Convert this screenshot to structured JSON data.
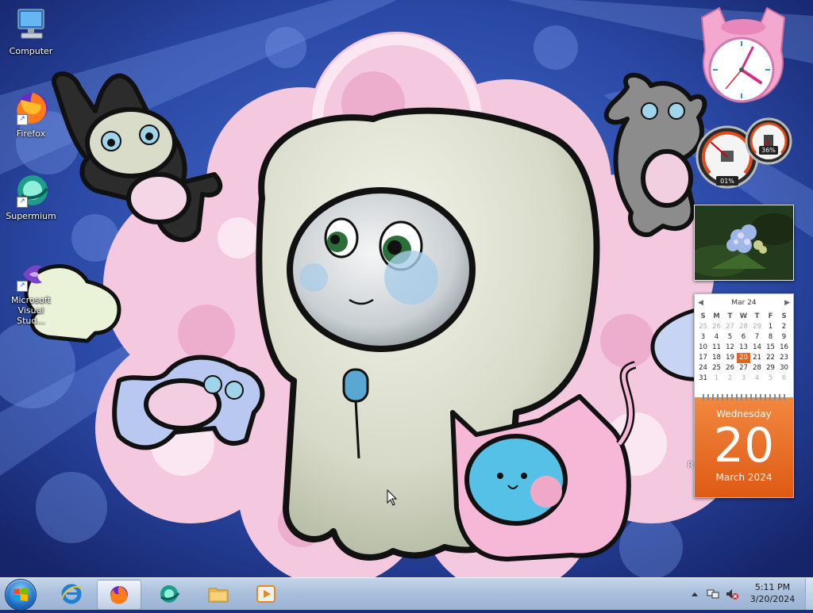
{
  "desktop": {
    "icons": [
      {
        "label": "Computer",
        "icon": "computer-icon"
      },
      {
        "label": "Firefox",
        "icon": "firefox-icon"
      },
      {
        "label": "Supermium",
        "icon": "supermium-icon"
      },
      {
        "label": "Microsoft Visual Stud...",
        "icon": "visual-studio-icon"
      }
    ]
  },
  "gadgets": {
    "cpu_meter": {
      "cpu": "01%",
      "memory": "36%",
      "cpu_level": 0.01,
      "memory_level": 0.36
    },
    "calendar": {
      "month_label": "Mar 24",
      "weekdays": [
        "S",
        "M",
        "T",
        "W",
        "T",
        "F",
        "S"
      ],
      "weeks": [
        [
          "25",
          "26",
          "27",
          "28",
          "29",
          "1",
          "2"
        ],
        [
          "3",
          "4",
          "5",
          "6",
          "7",
          "8",
          "9"
        ],
        [
          "10",
          "11",
          "12",
          "13",
          "14",
          "15",
          "16"
        ],
        [
          "17",
          "18",
          "19",
          "20",
          "21",
          "22",
          "23"
        ],
        [
          "24",
          "25",
          "26",
          "27",
          "28",
          "29",
          "30"
        ],
        [
          "31",
          "1",
          "2",
          "3",
          "4",
          "5",
          "6"
        ]
      ],
      "day_name": "Wednesday",
      "day_number": "20",
      "month_year": "March 2024"
    }
  },
  "stray_label": "R",
  "taskbar": {
    "pinned": [
      {
        "name": "internet-explorer",
        "icon": "internet-explorer-icon",
        "active": false
      },
      {
        "name": "firefox",
        "icon": "firefox-icon",
        "active": true
      },
      {
        "name": "supermium",
        "icon": "supermium-icon",
        "active": false
      },
      {
        "name": "file-explorer",
        "icon": "folder-icon",
        "active": false
      },
      {
        "name": "media-player",
        "icon": "media-player-icon",
        "active": false
      }
    ],
    "clock": {
      "time": "5:11 PM",
      "date": "3/20/2024"
    }
  },
  "colors": {
    "calendar_accent": "#e5641c",
    "taskbar": "#b4c7e0"
  }
}
